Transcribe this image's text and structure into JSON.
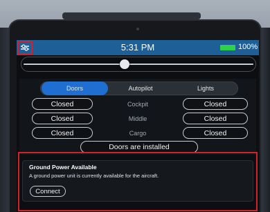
{
  "status_bar": {
    "time": "5:31 PM",
    "battery_percent": "100%",
    "battery_level": 1.0,
    "battery_color": "#2ed14a",
    "menu_icon": "sliders-icon"
  },
  "brightness_slider": {
    "value": 0.44
  },
  "tabs": [
    {
      "label": "Doors",
      "active": true
    },
    {
      "label": "Autopilot",
      "active": false
    },
    {
      "label": "Lights",
      "active": false
    }
  ],
  "doors": [
    {
      "left_state": "Closed",
      "name": "Cockpit",
      "right_state": "Closed"
    },
    {
      "left_state": "Closed",
      "name": "Middle",
      "right_state": "Closed"
    },
    {
      "left_state": "Closed",
      "name": "Cargo",
      "right_state": "Closed"
    }
  ],
  "doors_status": "Doors are installed",
  "ground_power": {
    "title": "Ground Power Available",
    "message": "A ground power unit is currently available for the aircraft.",
    "button_label": "Connect"
  },
  "colors": {
    "status_bar": "#1f5f98",
    "active_tab": "#1e6fd1",
    "highlight": "#d0232a"
  }
}
